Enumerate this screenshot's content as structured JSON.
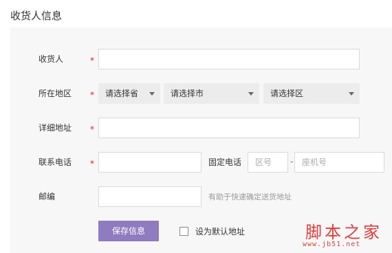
{
  "section_title": "收货人信息",
  "form": {
    "recipient": {
      "label": "收货人",
      "required": "*",
      "value": ""
    },
    "region": {
      "label": "所在地区",
      "required": "*",
      "province": "请选择省",
      "city": "请选择市",
      "district": "请选择区"
    },
    "address": {
      "label": "详细地址",
      "required": "*",
      "value": ""
    },
    "phone": {
      "label": "联系电话",
      "required": "*",
      "value": ""
    },
    "landline": {
      "label": "固定电话",
      "area_code_placeholder": "区号",
      "separator": "-",
      "number_placeholder": "座机号"
    },
    "postcode": {
      "label": "邮编",
      "value": "",
      "hint": "有助于快速确定送货地址"
    }
  },
  "actions": {
    "save_label": "保存信息",
    "default_checkbox_label": "设为默认地址",
    "default_checked": false
  },
  "watermark": {
    "main": "脚本之家",
    "sub": "www.jb51.net"
  },
  "colors": {
    "accent": "#8e7bc0",
    "required": "#e02020",
    "panel_bg": "#f7f7f7",
    "select_bg": "#ececec"
  }
}
